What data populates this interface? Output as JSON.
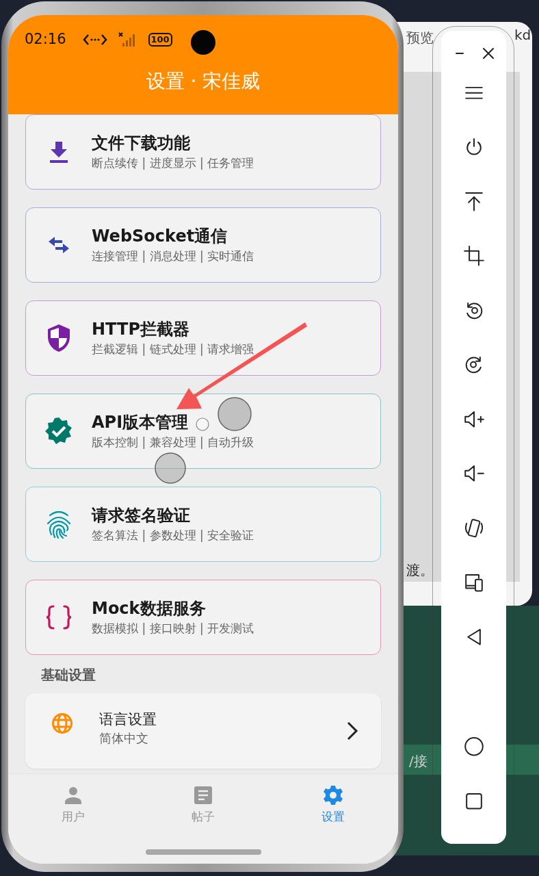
{
  "desktop": {
    "texts": [
      "预览",
      "kd",
      "渡。",
      "/接"
    ]
  },
  "status_bar": {
    "time": "02:16",
    "battery": "100"
  },
  "app_bar": {
    "title": "设置 · 宋佳威"
  },
  "feature_cards": [
    {
      "kind": "download",
      "title": "文件下载功能",
      "subtitle": "断点续传 | 进度显示 | 任务管理",
      "color": "#5e35b1"
    },
    {
      "kind": "swap",
      "title": "WebSocket通信",
      "subtitle": "连接管理 | 消息处理 | 实时通信",
      "color": "#3949ab"
    },
    {
      "kind": "shield",
      "title": "HTTP拦截器",
      "subtitle": "拦截逻辑 | 链式处理 | 请求增强",
      "color": "#7b1fa2"
    },
    {
      "kind": "badge",
      "title": "API版本管理",
      "subtitle": "版本控制 | 兼容处理 | 自动升级",
      "color": "#00796b"
    },
    {
      "kind": "fingerprint",
      "title": "请求签名验证",
      "subtitle": "签名算法 | 参数处理 | 安全验证",
      "color": "#0097a7"
    },
    {
      "kind": "braces",
      "title": "Mock数据服务",
      "subtitle": "数据模拟 | 接口映射 | 开发测试",
      "color": "#c2185b"
    }
  ],
  "section": {
    "title": "基础设置"
  },
  "settings": [
    {
      "kind": "globe",
      "title": "语言设置",
      "value": "简体中文"
    }
  ],
  "bottom_nav": [
    {
      "kind": "person",
      "label": "用户",
      "selected": false
    },
    {
      "kind": "article",
      "label": "帖子",
      "selected": false
    },
    {
      "kind": "gear",
      "label": "设置",
      "selected": true
    }
  ]
}
